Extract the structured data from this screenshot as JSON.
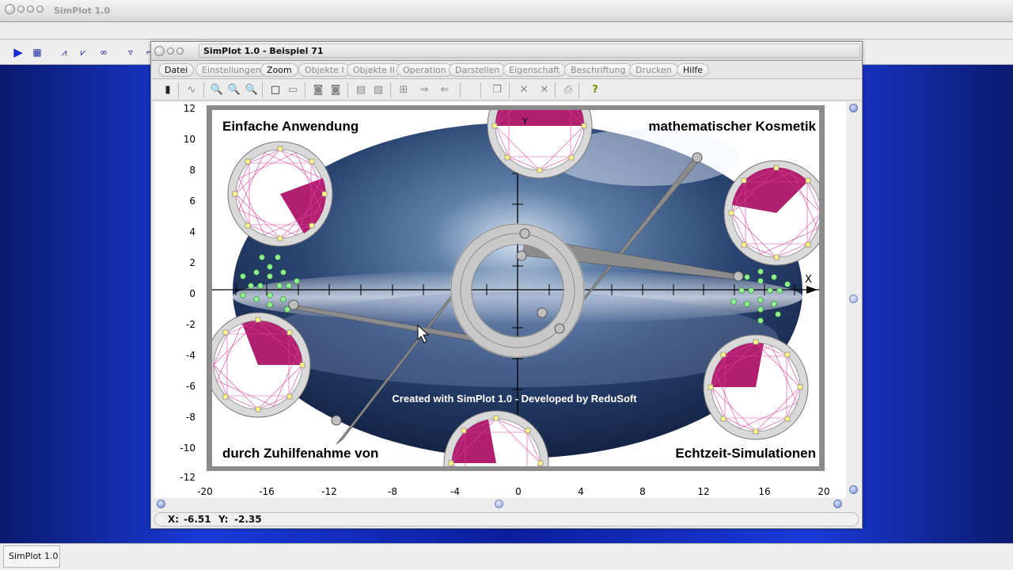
{
  "app": {
    "title": "SimPlot 1.0",
    "taskbar_label": "SimPlot 1.0"
  },
  "doc": {
    "title": "SimPlot 1.0 - Beispiel 71",
    "menu": [
      "Datei",
      "Einstellungen",
      "Zoom",
      "Objekte I",
      "Objekte II",
      "Operation",
      "Darstellen",
      "Eigenschaft",
      "Beschriftung",
      "Drucken",
      "Hilfe"
    ],
    "menu_active": [
      "Datei",
      "Zoom",
      "Hilfe"
    ],
    "status": {
      "x_label": "X:",
      "x_value": "-6.51",
      "y_label": "Y:",
      "y_value": "-2.35"
    }
  },
  "plot": {
    "x_ticks": [
      "-20",
      "-16",
      "-12",
      "-8",
      "-4",
      "0",
      "4",
      "8",
      "12",
      "16",
      "20"
    ],
    "y_ticks": [
      "12",
      "10",
      "8",
      "6",
      "4",
      "2",
      "0",
      "-2",
      "-4",
      "-6",
      "-8",
      "-10",
      "-12"
    ],
    "axis_x_label": "X",
    "axis_y_label": "Y",
    "text_top_left": "Einfache Anwendung",
    "text_top_right": "mathematischer Kosmetik",
    "text_bottom_left": "durch Zuhilfenahme von",
    "text_bottom_right": "Echtzeit-Simulationen",
    "credit": "Created with SimPlot 1.0 - Developed by ReduSoft"
  },
  "colors": {
    "desktop": "#1a3ad8",
    "rosette_fill": "#b0206e",
    "rosette_lines": "#e040a0",
    "node_yellow": "#fff38a",
    "node_green": "#8ef08e",
    "shape_gray": "#8c8c8c"
  }
}
